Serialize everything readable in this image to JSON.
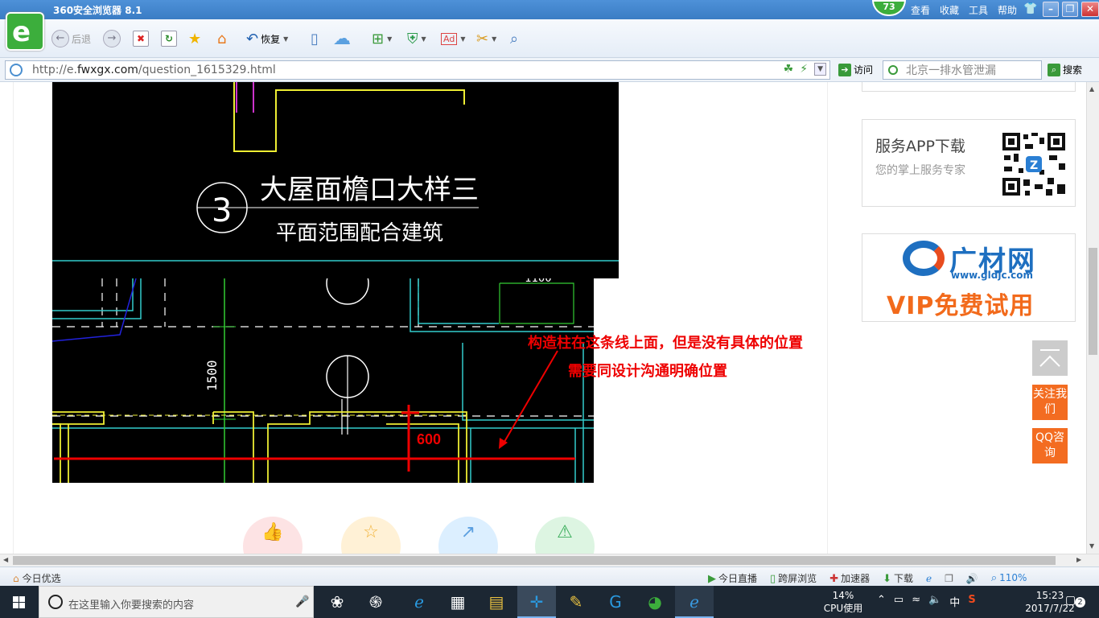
{
  "browser": {
    "title": "360安全浏览器 8.1",
    "badge_count": "73",
    "menus": [
      "查看",
      "收藏",
      "工具",
      "帮助"
    ],
    "back_label": "后退",
    "restore_label": "恢复",
    "url_prefix": "http://e.",
    "url_domain": "fwxgx.com",
    "url_path": "/question_1615329.html",
    "visit_label": "访问",
    "search_placeholder": "北京一排水管泄漏",
    "search_label": "搜索"
  },
  "page": {
    "cad_title": "大屋面檐口大样三",
    "cad_subtitle": "平面范围配合建筑",
    "cad_number": "3",
    "cad_dim_vertical": "1500",
    "cad_dim_top": "1100",
    "annotation_line1": "构造柱在这条线上面，但是没有具体的位置",
    "annotation_line2": "需要同设计沟通明确位置",
    "dimension_label": "600"
  },
  "sidebar": {
    "app_title": "服务APP下载",
    "app_subtitle": "您的掌上服务专家",
    "ad_name": "广材网",
    "ad_url": "www.gldjc.com",
    "ad_vip": "VIP免费试用",
    "follow_label": "关注我们",
    "qq_label": "QQ咨询"
  },
  "statusbar": {
    "left_label": "今日优选",
    "items": [
      "今日直播",
      "跨屏浏览",
      "加速器",
      "下载",
      "110%"
    ]
  },
  "taskbar": {
    "search_placeholder": "在这里输入你要搜索的内容",
    "cpu_percent": "14%",
    "cpu_label": "CPU使用",
    "ime": "中",
    "time": "15:23",
    "date": "2017/7/22",
    "notifications": "2"
  },
  "colors": {
    "accent_green": "#3cae3c",
    "annotation_red": "#e00000",
    "sidebar_orange": "#f36c21",
    "cad_background": "#000000"
  }
}
